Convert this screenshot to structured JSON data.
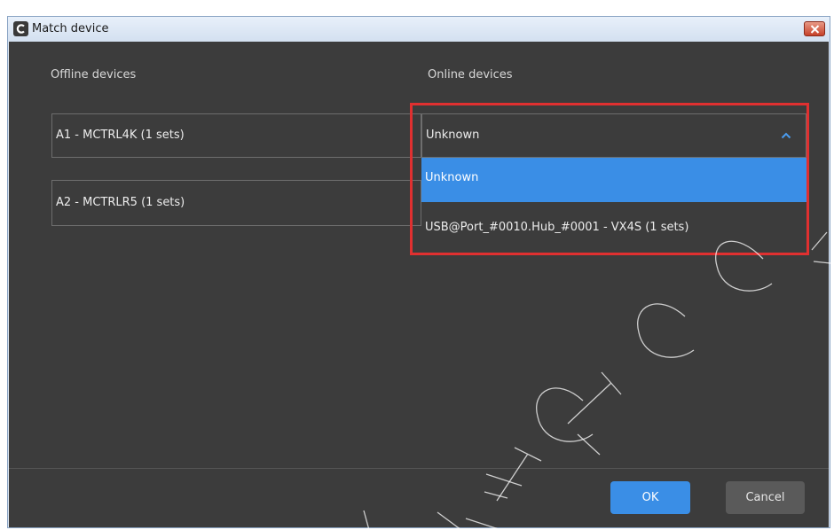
{
  "window": {
    "title": "Match device",
    "close_icon": "close-icon"
  },
  "offline": {
    "heading": "Offline devices",
    "devices": [
      "A1 - MCTRL4K (1 sets)",
      "A2 - MCTRLR5 (1 sets)"
    ]
  },
  "online": {
    "heading": "Online devices",
    "selected_value": "Unknown",
    "options": [
      "Unknown",
      "USB@Port_#0010.Hub_#0001 - VX4S (1 sets)"
    ]
  },
  "footer": {
    "ok_label": "OK",
    "cancel_label": "Cancel"
  },
  "colors": {
    "panel_bg": "#3c3c3c",
    "accent_blue": "#3a8ee6",
    "highlight_red": "#e03030"
  }
}
